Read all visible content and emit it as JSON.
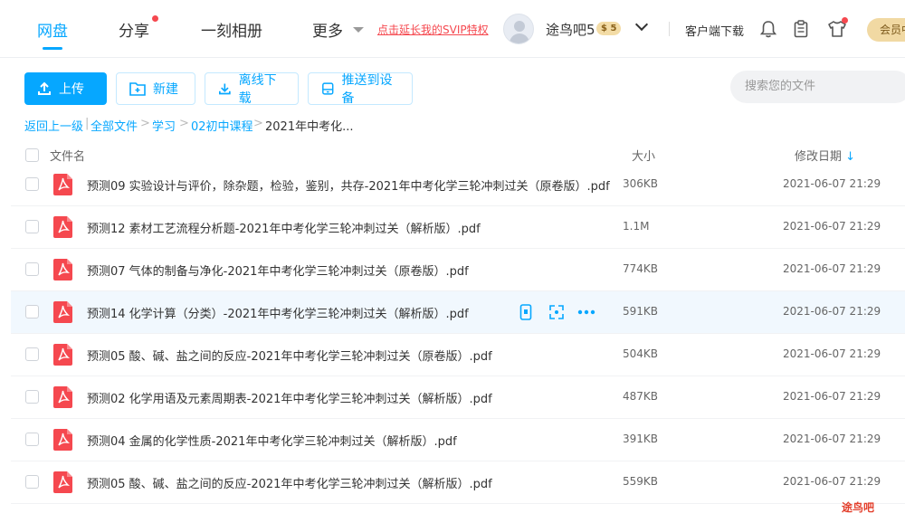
{
  "nav": {
    "tabs": [
      "网盘",
      "分享",
      "一刻相册",
      "更多"
    ],
    "promo": "点击延长我的SVIP特权",
    "username": "途鸟吧5",
    "vip_level": "5",
    "client_download": "客户端下载",
    "vip_button": "会员中"
  },
  "toolbar": {
    "upload": "上传",
    "new": "新建",
    "offline": "离线下载",
    "push": "推送到设备",
    "search_placeholder": "搜索您的文件"
  },
  "breadcrumb": [
    "返回上一级",
    "全部文件",
    "学习",
    "02初中课程",
    "2021年中考化..."
  ],
  "table": {
    "headers": {
      "name": "文件名",
      "size": "大小",
      "date": "修改日期"
    },
    "rows": [
      {
        "name": "预测09 实验设计与评价，除杂题，检验，鉴别，共存-2021年中考化学三轮冲刺过关（原卷版）.pdf",
        "size": "306KB",
        "date": "2021-06-07 21:29"
      },
      {
        "name": "预测12 素材工艺流程分析题-2021年中考化学三轮冲刺过关（解析版）.pdf",
        "size": "1.1M",
        "date": "2021-06-07 21:29"
      },
      {
        "name": "预测07 气体的制备与净化-2021年中考化学三轮冲刺过关（原卷版）.pdf",
        "size": "774KB",
        "date": "2021-06-07 21:29"
      },
      {
        "name": "预测14 化学计算（分类）-2021年中考化学三轮冲刺过关（解析版）.pdf",
        "size": "591KB",
        "date": "2021-06-07 21:29"
      },
      {
        "name": "预测05 酸、碱、盐之间的反应-2021年中考化学三轮冲刺过关（原卷版）.pdf",
        "size": "504KB",
        "date": "2021-06-07 21:29"
      },
      {
        "name": "预测02 化学用语及元素周期表-2021年中考化学三轮冲刺过关（解析版）.pdf",
        "size": "487KB",
        "date": "2021-06-07 21:29"
      },
      {
        "name": "预测04 金属的化学性质-2021年中考化学三轮冲刺过关（解析版）.pdf",
        "size": "391KB",
        "date": "2021-06-07 21:29"
      },
      {
        "name": "预测05 酸、碱、盐之间的反应-2021年中考化学三轮冲刺过关（解析版）.pdf",
        "size": "559KB",
        "date": "2021-06-07 21:29"
      }
    ]
  },
  "watermark": "途鸟吧",
  "colors": {
    "accent": "#06a7ff",
    "pdf_red": "#f5484f",
    "hover_row": "#f1f8fe"
  }
}
